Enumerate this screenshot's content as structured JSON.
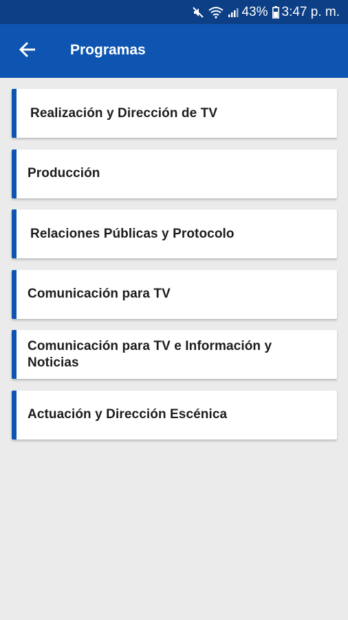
{
  "status_bar": {
    "battery_percent": "43%",
    "time": "3:47 p. m.",
    "icons": [
      "mute-icon",
      "wifi-icon",
      "signal-icon",
      "battery-icon"
    ]
  },
  "app_bar": {
    "title": "Programas",
    "back_icon": "arrow-left-icon"
  },
  "programs": [
    {
      "label": "Realización y Dirección de TV"
    },
    {
      "label": "Producción"
    },
    {
      "label": "Relaciones Públicas y Protocolo"
    },
    {
      "label": "Comunicación para TV"
    },
    {
      "label": "Comunicación para TV e Información y Noticias"
    },
    {
      "label": "Actuación y Dirección Escénica"
    }
  ],
  "colors": {
    "status_bar": "#0d3f86",
    "app_bar": "#0d55b0",
    "accent": "#0d55b0",
    "background": "#ebebeb"
  }
}
